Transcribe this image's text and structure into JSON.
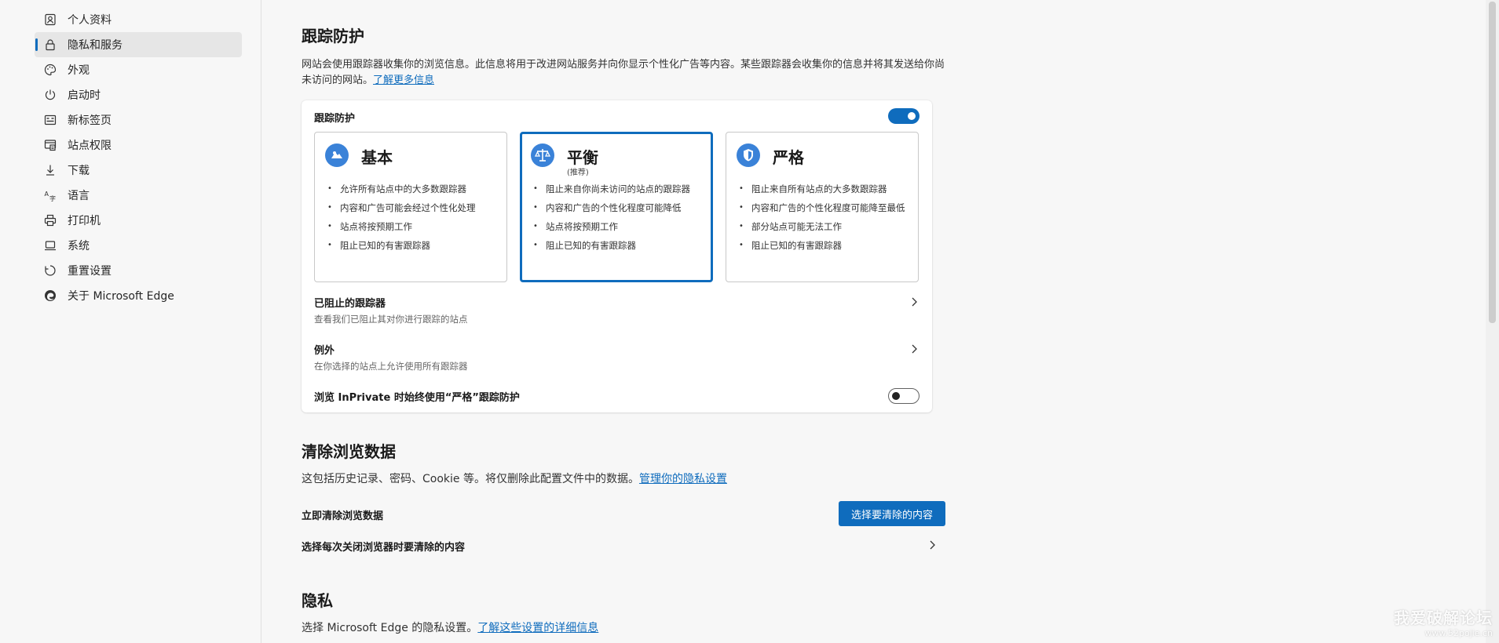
{
  "sidebar": {
    "items": [
      {
        "label": "个人资料",
        "icon": "profile-icon"
      },
      {
        "label": "隐私和服务",
        "icon": "lock-icon",
        "active": true
      },
      {
        "label": "外观",
        "icon": "palette-icon"
      },
      {
        "label": "启动时",
        "icon": "power-icon"
      },
      {
        "label": "新标签页",
        "icon": "new-tab-icon"
      },
      {
        "label": "站点权限",
        "icon": "site-permissions-icon"
      },
      {
        "label": "下载",
        "icon": "download-icon"
      },
      {
        "label": "语言",
        "icon": "language-icon"
      },
      {
        "label": "打印机",
        "icon": "printer-icon"
      },
      {
        "label": "系统",
        "icon": "system-icon"
      },
      {
        "label": "重置设置",
        "icon": "reset-icon"
      },
      {
        "label": "关于 Microsoft Edge",
        "icon": "edge-logo-icon"
      }
    ]
  },
  "tracking": {
    "title": "跟踪防护",
    "description": "网站会使用跟踪器收集你的浏览信息。此信息将用于改进网站服务并向你显示个性化广告等内容。某些跟踪器会收集你的信息并将其发送给你尚未访问的网站。",
    "learn_more": "了解更多信息",
    "card_label": "跟踪防护",
    "toggle_on": true,
    "levels": [
      {
        "title": "基本",
        "subtitle": "",
        "items": [
          "允许所有站点中的大多数跟踪器",
          "内容和广告可能会经过个性化处理",
          "站点将按预期工作",
          "阻止已知的有害跟踪器"
        ]
      },
      {
        "title": "平衡",
        "subtitle": "(推荐)",
        "selected": true,
        "items": [
          "阻止来自你尚未访问的站点的跟踪器",
          "内容和广告的个性化程度可能降低",
          "站点将按预期工作",
          "阻止已知的有害跟踪器"
        ]
      },
      {
        "title": "严格",
        "subtitle": "",
        "items": [
          "阻止来自所有站点的大多数跟踪器",
          "内容和广告的个性化程度可能降至最低",
          "部分站点可能无法工作",
          "阻止已知的有害跟踪器"
        ]
      }
    ],
    "blocked": {
      "title": "已阻止的跟踪器",
      "sub": "查看我们已阻止其对你进行跟踪的站点"
    },
    "exceptions": {
      "title": "例外",
      "sub": "在你选择的站点上允许使用所有跟踪器"
    },
    "inprivate": {
      "label": "浏览 InPrivate 时始终使用“严格”跟踪防护",
      "toggle_on": false
    }
  },
  "clear": {
    "title": "清除浏览数据",
    "description": "这包括历史记录、密码、Cookie 等。将仅删除此配置文件中的数据。",
    "manage_link": "管理你的隐私设置",
    "now_label": "立即清除浏览数据",
    "button_label": "选择要清除的内容",
    "on_close_label": "选择每次关闭浏览器时要清除的内容"
  },
  "privacy": {
    "title": "隐私",
    "description": "选择 Microsoft Edge 的隐私设置。",
    "details_link": "了解这些设置的详细信息"
  },
  "watermark": {
    "line1": "我爱破解论坛",
    "line2": "www.52pojie.cn"
  },
  "colors": {
    "accent": "#0f6cbd",
    "background": "#f7f7f7",
    "card": "#ffffff"
  }
}
